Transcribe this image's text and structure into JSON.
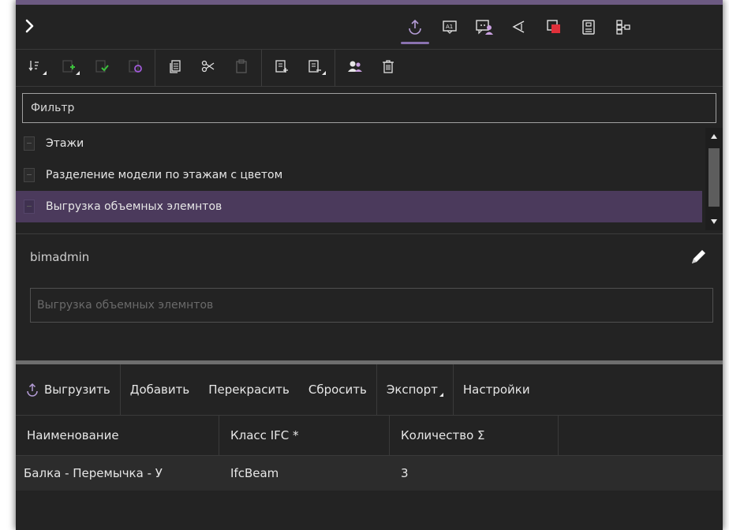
{
  "header": {
    "collapse_icon": "chevron-right-icon",
    "tabs": [
      {
        "name": "export-tab",
        "icon": "upload-icon",
        "active": true
      },
      {
        "name": "annotation-tab",
        "icon": "label-a1-icon",
        "active": false
      },
      {
        "name": "comments-tab",
        "icon": "comment-user-icon",
        "active": false
      },
      {
        "name": "views-tab",
        "icon": "viewpoint-icon",
        "active": false
      },
      {
        "name": "colors-tab",
        "icon": "color-overlay-icon",
        "active": false
      },
      {
        "name": "report-tab",
        "icon": "clipboard-icon",
        "active": false
      },
      {
        "name": "structure-tab",
        "icon": "hierarchy-icon",
        "active": false
      }
    ],
    "accent_color": "#8a72b0"
  },
  "toolbar": {
    "groups": [
      [
        "sort-icon",
        "add-set-icon",
        "apply-set-icon",
        "refresh-set-icon"
      ],
      [
        "copy-icon",
        "cut-icon",
        "paste-icon"
      ],
      [
        "import-list-icon",
        "export-list-icon"
      ],
      [
        "users-icon",
        "delete-icon"
      ]
    ]
  },
  "filter": {
    "placeholder": "Фильтр",
    "value": ""
  },
  "list": {
    "items": [
      {
        "label": "Этажи",
        "selected": false
      },
      {
        "label": "Разделение модели по этажам с цветом",
        "selected": false
      },
      {
        "label": "Выгрузка объемных элемнтов",
        "selected": true
      }
    ],
    "selected_color": "#4b3a5c"
  },
  "details": {
    "author": "bimadmin",
    "description_placeholder": "Выгрузка объемных элемнтов"
  },
  "actions": {
    "upload": "Выгрузить",
    "add": "Добавить",
    "recolor": "Перекрасить",
    "reset": "Сбросить",
    "export": "Экспорт",
    "settings": "Настройки"
  },
  "table": {
    "headers": [
      "Наименование",
      "Класс IFC *",
      "Количество Σ",
      ""
    ],
    "rows": [
      [
        "Балка - Перемычка - У",
        "IfcBeam",
        "3",
        ""
      ]
    ]
  }
}
